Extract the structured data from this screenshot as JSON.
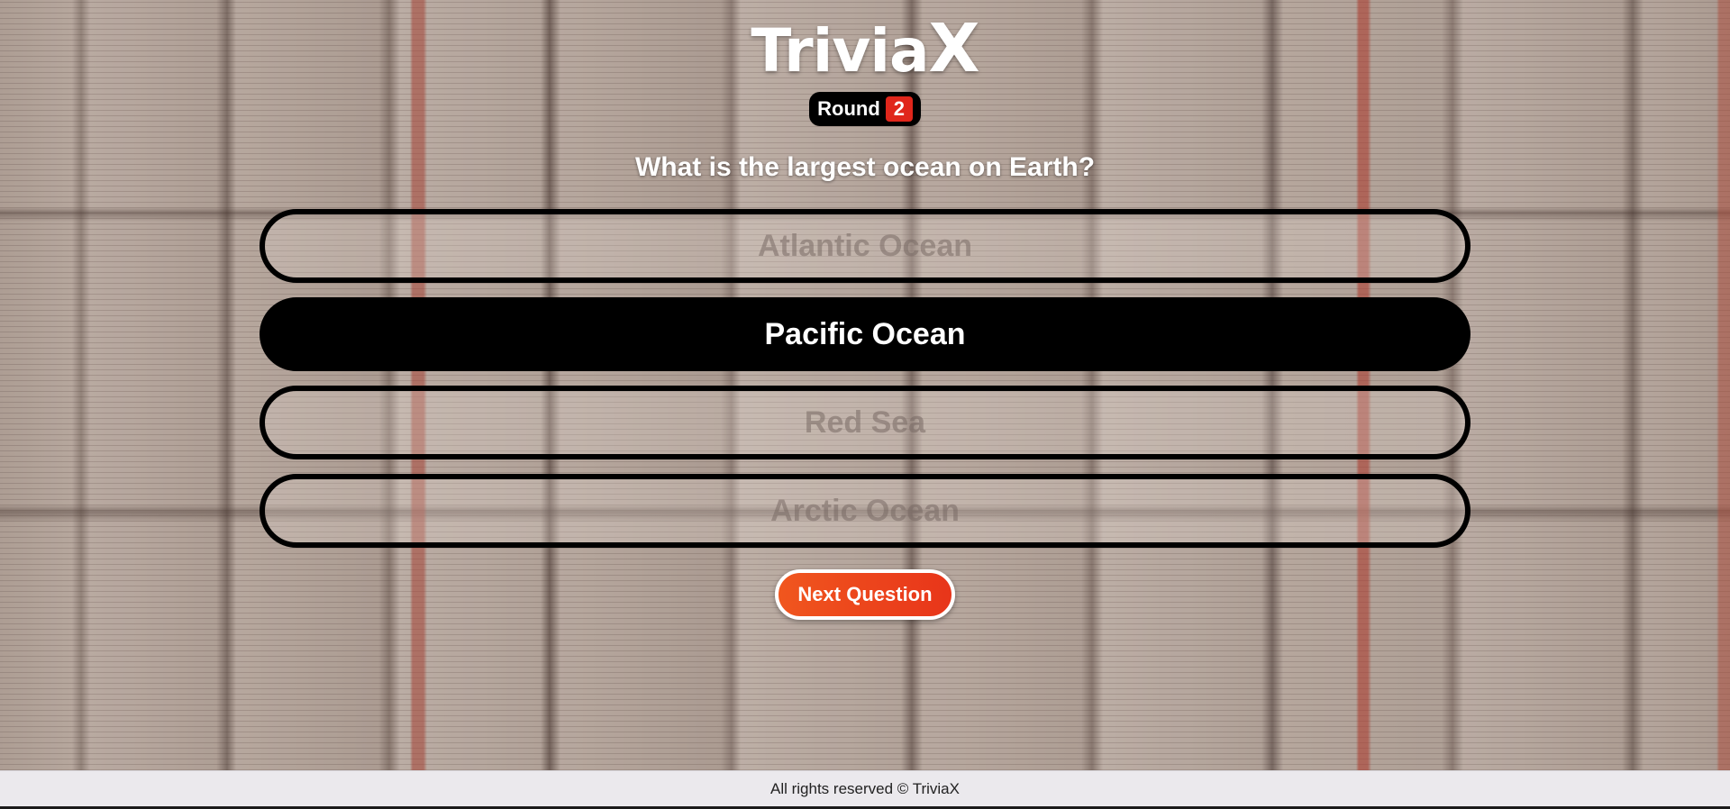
{
  "app": {
    "logo_main": "Trivia",
    "logo_x": "X"
  },
  "round": {
    "label": "Round",
    "number": "2"
  },
  "question": {
    "text": "What is the largest ocean on Earth?"
  },
  "options": [
    {
      "label": "Atlantic Ocean",
      "state": "dim"
    },
    {
      "label": "Pacific Ocean",
      "state": "selected"
    },
    {
      "label": "Red Sea",
      "state": "dim"
    },
    {
      "label": "Arctic Ocean",
      "state": "dim"
    }
  ],
  "actions": {
    "next_label": "Next Question"
  },
  "footer": {
    "text": "All rights reserved © TriviaX"
  },
  "colors": {
    "accent_orange": "#f0561e",
    "accent_red": "#e0261b",
    "selected_bg": "#000000",
    "footer_bg": "#ebe9ed"
  }
}
